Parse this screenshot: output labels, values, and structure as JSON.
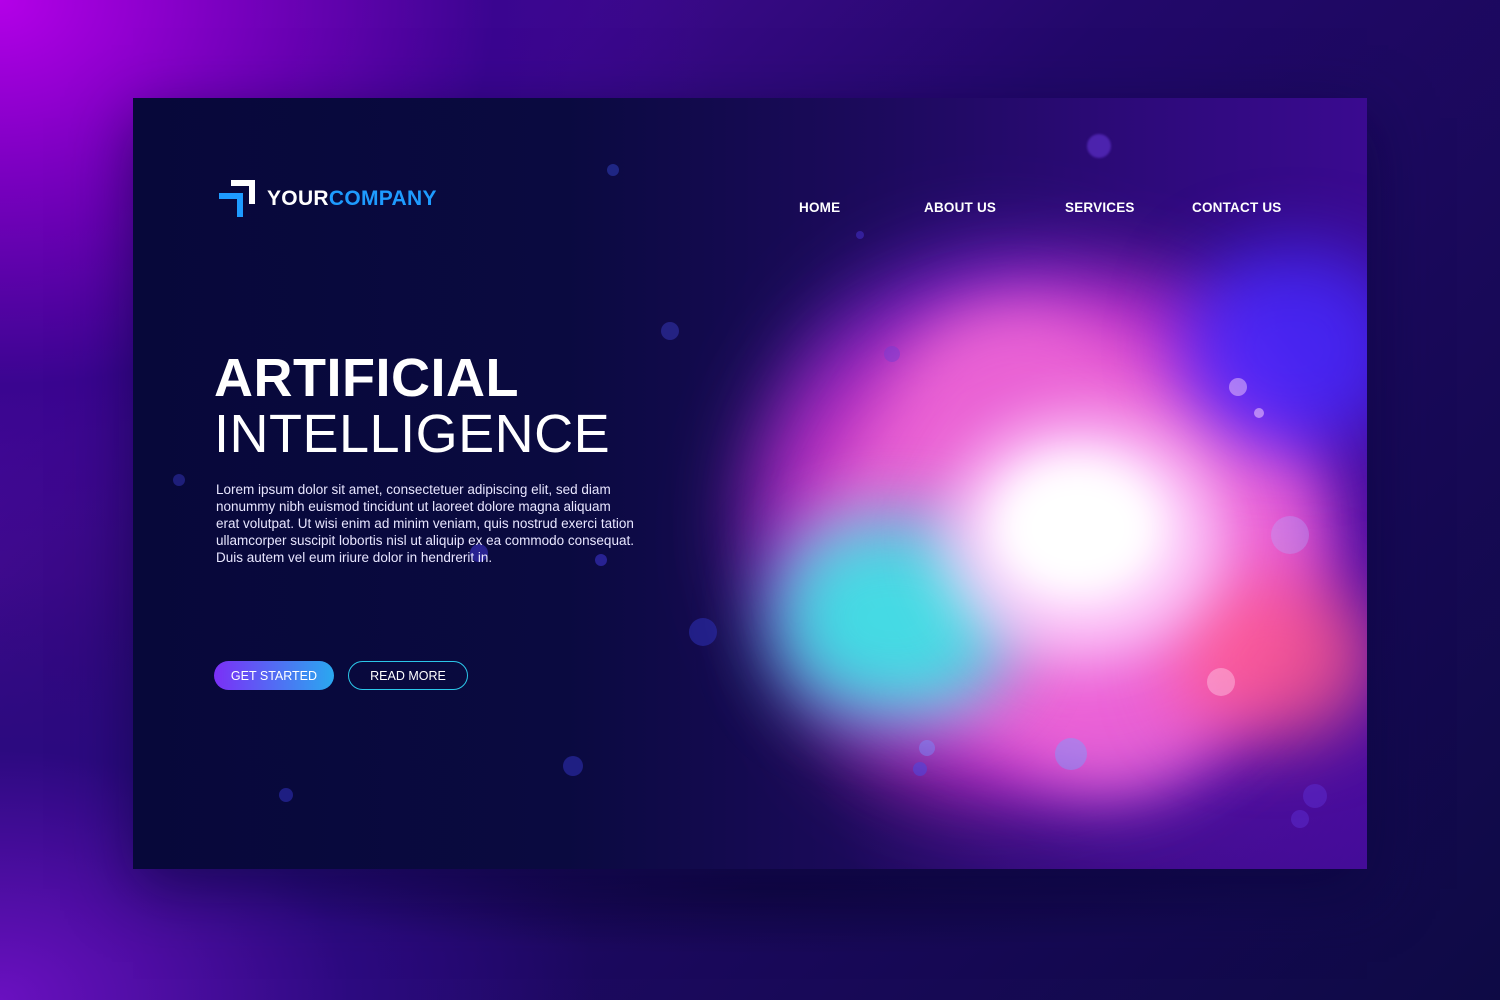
{
  "brand": {
    "name_part1": "YOUR",
    "name_part2": "COMPANY"
  },
  "nav": {
    "items": [
      {
        "label": "HOME"
      },
      {
        "label": "ABOUT US"
      },
      {
        "label": "SERVICES"
      },
      {
        "label": "CONTACT US"
      }
    ]
  },
  "hero": {
    "title_line1": "ARTIFICIAL",
    "title_line2": "INTELLIGENCE",
    "body": "Lorem ipsum dolor sit amet, consectetuer adipiscing elit, sed diam nonummy nibh euismod tincidunt ut laoreet dolore magna aliquam erat volutpat. Ut wisi enim ad minim veniam, quis nostrud exerci tation ullamcorper suscipit lobortis nisl ut aliquip ex ea commodo consequat. Duis autem vel eum iriure dolor in hendrerit in.",
    "primary_button": "GET STARTED",
    "secondary_button": "READ MORE"
  },
  "colors": {
    "accent_blue": "#1e9bff",
    "button_gradient_start": "#7b2ff7",
    "button_gradient_end": "#2aa8f0",
    "outline_button": "#2bc6e8",
    "card_background": "#0a0a40"
  },
  "icons": {
    "logo": "corner-arrow-logo-icon"
  }
}
